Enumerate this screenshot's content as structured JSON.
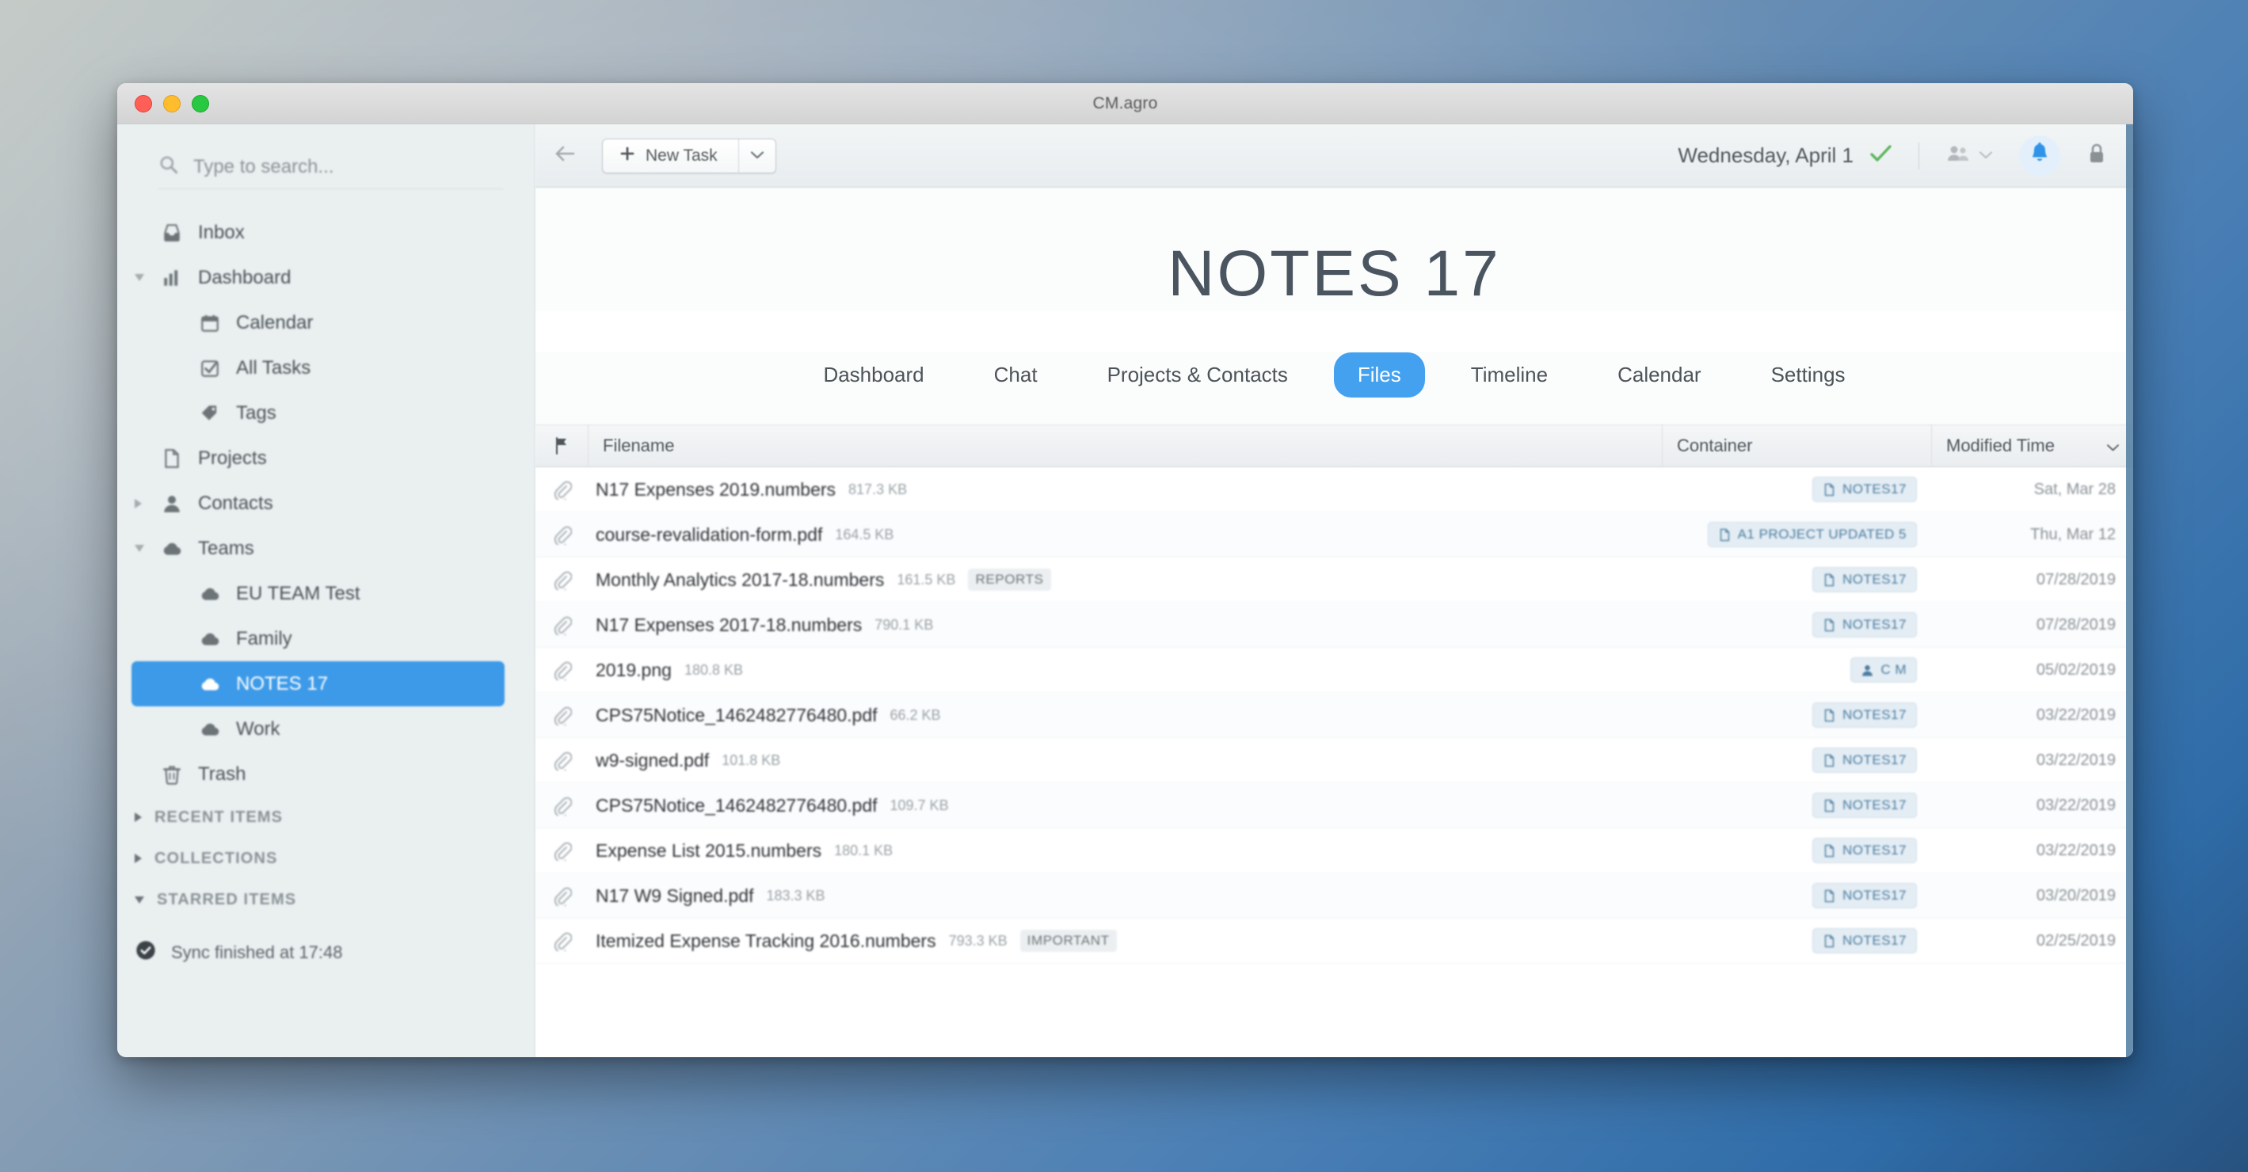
{
  "window": {
    "title": "CM.agro"
  },
  "sidebar": {
    "search": {
      "placeholder": "Type to search..."
    },
    "items": [
      {
        "label": "Inbox",
        "icon": "inbox-icon",
        "level": 0,
        "twisty": "none"
      },
      {
        "label": "Dashboard",
        "icon": "chart-icon",
        "level": 0,
        "twisty": "open"
      },
      {
        "label": "Calendar",
        "icon": "calendar-icon",
        "level": 1,
        "twisty": "none"
      },
      {
        "label": "All Tasks",
        "icon": "checkbox-icon",
        "level": 1,
        "twisty": "none"
      },
      {
        "label": "Tags",
        "icon": "tag-icon",
        "level": 1,
        "twisty": "none"
      },
      {
        "label": "Projects",
        "icon": "document-icon",
        "level": 0,
        "twisty": "none"
      },
      {
        "label": "Contacts",
        "icon": "person-icon",
        "level": 0,
        "twisty": "closed"
      },
      {
        "label": "Teams",
        "icon": "cloud-icon",
        "level": 0,
        "twisty": "open"
      },
      {
        "label": "EU TEAM Test",
        "icon": "cloud-icon",
        "level": 1,
        "twisty": "none"
      },
      {
        "label": "Family",
        "icon": "cloud-icon",
        "level": 1,
        "twisty": "none"
      },
      {
        "label": "NOTES 17",
        "icon": "cloud-icon",
        "level": 1,
        "twisty": "none",
        "selected": true
      },
      {
        "label": "Work",
        "icon": "cloud-icon",
        "level": 1,
        "twisty": "none"
      },
      {
        "label": "Trash",
        "icon": "trash-icon",
        "level": 0,
        "twisty": "none"
      }
    ],
    "sections": [
      {
        "label": "RECENT ITEMS",
        "twisty": "closed"
      },
      {
        "label": "COLLECTIONS",
        "twisty": "closed"
      },
      {
        "label": "STARRED ITEMS",
        "twisty": "open"
      }
    ],
    "sync_status": "Sync finished at 17:48"
  },
  "toolbar": {
    "back_icon": "back-arrow-icon",
    "new_task_label": "New Task",
    "date_label": "Wednesday, April 1",
    "check_icon": "green-check-icon",
    "users_icon": "users-icon",
    "bell_icon": "bell-icon",
    "lock_icon": "lock-icon"
  },
  "main": {
    "heading": "NOTES 17",
    "tabs": [
      {
        "label": "Dashboard",
        "active": false
      },
      {
        "label": "Chat",
        "active": false
      },
      {
        "label": "Projects & Contacts",
        "active": false
      },
      {
        "label": "Files",
        "active": true
      },
      {
        "label": "Timeline",
        "active": false
      },
      {
        "label": "Calendar",
        "active": false
      },
      {
        "label": "Settings",
        "active": false
      }
    ],
    "table": {
      "columns": {
        "flag": "flag-icon",
        "filename": "Filename",
        "container": "Container",
        "modified": "Modified Time"
      },
      "rows": [
        {
          "filename": "N17 Expenses 2019.numbers",
          "size": "817.3 KB",
          "tag": "",
          "container": "NOTES17",
          "container_icon": "document-icon",
          "modified": "Sat, Mar 28"
        },
        {
          "filename": "course-revalidation-form.pdf",
          "size": "164.5 KB",
          "tag": "",
          "container": "A1 PROJECT UPDATED 5",
          "container_icon": "document-icon",
          "modified": "Thu, Mar 12"
        },
        {
          "filename": "Monthly Analytics 2017-18.numbers",
          "size": "161.5 KB",
          "tag": "REPORTS",
          "container": "NOTES17",
          "container_icon": "document-icon",
          "modified": "07/28/2019"
        },
        {
          "filename": "N17 Expenses 2017-18.numbers",
          "size": "790.1 KB",
          "tag": "",
          "container": "NOTES17",
          "container_icon": "document-icon",
          "modified": "07/28/2019"
        },
        {
          "filename": "2019.png",
          "size": "180.8 KB",
          "tag": "",
          "container": "C M",
          "container_icon": "person-icon",
          "modified": "05/02/2019"
        },
        {
          "filename": "CPS75Notice_1462482776480.pdf",
          "size": "66.2 KB",
          "tag": "",
          "container": "NOTES17",
          "container_icon": "document-icon",
          "modified": "03/22/2019"
        },
        {
          "filename": "w9-signed.pdf",
          "size": "101.8 KB",
          "tag": "",
          "container": "NOTES17",
          "container_icon": "document-icon",
          "modified": "03/22/2019"
        },
        {
          "filename": "CPS75Notice_1462482776480.pdf",
          "size": "109.7 KB",
          "tag": "",
          "container": "NOTES17",
          "container_icon": "document-icon",
          "modified": "03/22/2019"
        },
        {
          "filename": "Expense List 2015.numbers",
          "size": "180.1 KB",
          "tag": "",
          "container": "NOTES17",
          "container_icon": "document-icon",
          "modified": "03/22/2019"
        },
        {
          "filename": "N17 W9 Signed.pdf",
          "size": "183.3 KB",
          "tag": "",
          "container": "NOTES17",
          "container_icon": "document-icon",
          "modified": "03/20/2019"
        },
        {
          "filename": "Itemized Expense Tracking 2016.numbers",
          "size": "793.3 KB",
          "tag": "IMPORTANT",
          "container": "NOTES17",
          "container_icon": "document-icon",
          "modified": "02/25/2019"
        }
      ]
    }
  },
  "colors": {
    "accent": "#43a1ef",
    "selected_sidebar": "#3d9ae8",
    "badge_text": "#4b7ca0",
    "check_green": "#5db75d"
  }
}
